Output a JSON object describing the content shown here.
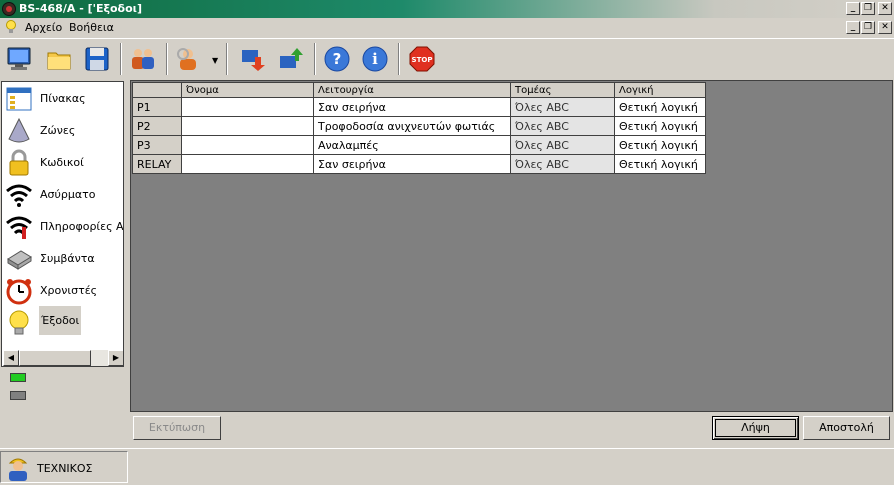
{
  "window": {
    "title": "BS-468/A - ['Εξοδοι]"
  },
  "menu": {
    "items": [
      "Αρχείο",
      "Βοήθεια"
    ]
  },
  "toolbar": {
    "buttons": [
      "computer-icon",
      "open-folder-icon",
      "save-disk-icon",
      "users-icon",
      "user-settings-icon",
      "download-icon",
      "upload-icon",
      "help-icon",
      "info-icon",
      "stop-icon"
    ]
  },
  "sidebar": {
    "items": [
      {
        "label": "Πίνακας",
        "icon": "panel-icon"
      },
      {
        "label": "Ζώνες",
        "icon": "zones-icon"
      },
      {
        "label": "Κωδικοί",
        "icon": "padlock-icon"
      },
      {
        "label": "Ασύρματο",
        "icon": "wireless-icon"
      },
      {
        "label": "Πληροφορίες Ασύ",
        "icon": "wireless-info-icon"
      },
      {
        "label": "Συμβάντα",
        "icon": "events-icon"
      },
      {
        "label": "Χρονιστές",
        "icon": "alarm-clock-icon"
      },
      {
        "label": "Έξοδοι",
        "icon": "light-bulb-icon",
        "selected": true
      }
    ]
  },
  "status_leds": {
    "led1_color": "#22cc22",
    "led2_color": "#808080"
  },
  "table": {
    "columns": [
      "",
      "Όνομα",
      "Λειτουργία",
      "Τομέας",
      "Λογική"
    ],
    "rows": [
      {
        "id": "P1",
        "name": "",
        "function": "Σαν σειρήνα",
        "sector": "Όλες ABC",
        "logic": "Θετική λογική"
      },
      {
        "id": "P2",
        "name": "",
        "function": "Τροφοδοσία ανιχνευτών φωτιάς",
        "sector": "Όλες ABC",
        "logic": "Θετική λογική"
      },
      {
        "id": "P3",
        "name": "",
        "function": "Αναλαμπές",
        "sector": "Όλες ABC",
        "logic": "Θετική λογική"
      },
      {
        "id": "RELAY",
        "name": "",
        "function": "Σαν σειρήνα",
        "sector": "Όλες ABC",
        "logic": "Θετική λογική"
      }
    ]
  },
  "buttons": {
    "print": "Εκτύπωση",
    "receive": "Λήψη",
    "send": "Αποστολή"
  },
  "status": {
    "user": "ΤΕΧΝΙΚΟΣ"
  }
}
